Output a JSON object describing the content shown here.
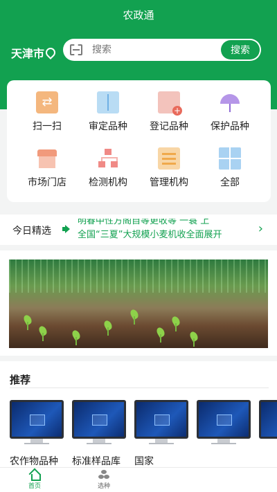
{
  "app": {
    "title": "农政通"
  },
  "header": {
    "city": "天津市",
    "search_placeholder": "搜索",
    "search_button": "搜索"
  },
  "colors": {
    "brand": "#12a150"
  },
  "quick_menu": [
    {
      "label": "扫一扫",
      "icon": "scan-refresh-icon"
    },
    {
      "label": "审定品种",
      "icon": "book-icon"
    },
    {
      "label": "登记品种",
      "icon": "register-form-icon"
    },
    {
      "label": "保护品种",
      "icon": "umbrella-icon"
    },
    {
      "label": "市场门店",
      "icon": "store-icon"
    },
    {
      "label": "检测机构",
      "icon": "org-chart-icon"
    },
    {
      "label": "管理机构",
      "icon": "newspaper-icon"
    },
    {
      "label": "全部",
      "icon": "grid-icon"
    }
  ],
  "ticker": {
    "title": "今日精选",
    "lines": [
      "明春中性方阁自等更收等 一蓑 上",
      "全国“三夏”大规模小麦机收全面展开"
    ]
  },
  "recommend": {
    "title": "推荐",
    "items": [
      "农作物品种",
      "标准样品库",
      "国家"
    ]
  },
  "tabbar": {
    "home": "首页",
    "seed": "选种"
  }
}
